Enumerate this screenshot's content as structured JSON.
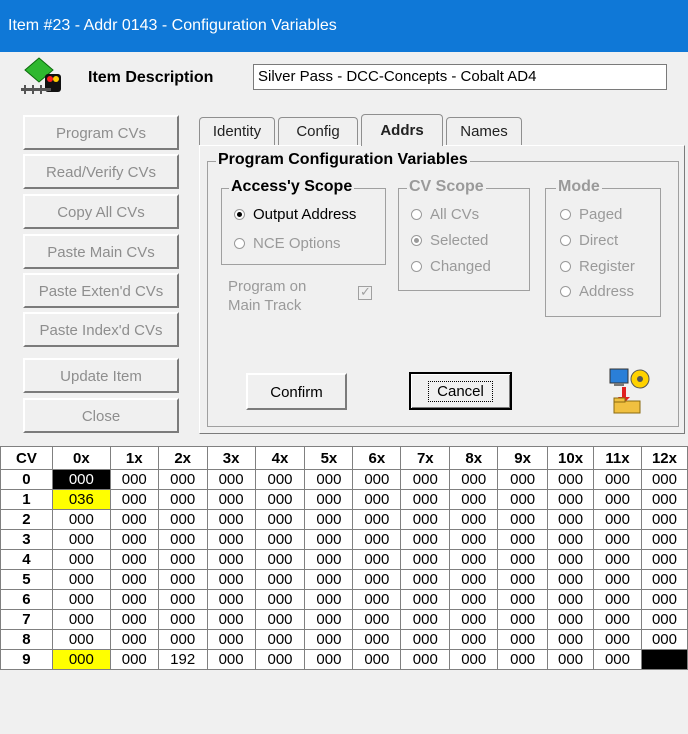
{
  "window": {
    "title": "Item #23 - Addr 0143 - Configuration Variables"
  },
  "header": {
    "desc_label": "Item Description",
    "desc_value": "Silver Pass - DCC-Concepts - Cobalt AD4"
  },
  "buttons": {
    "program_cvs": "Program CVs",
    "read_verify": "Read/Verify CVs",
    "copy_all": "Copy All CVs",
    "paste_main": "Paste Main CVs",
    "paste_extend": "Paste Exten'd CVs",
    "paste_index": "Paste Index'd CVs",
    "update_item": "Update Item",
    "close": "Close",
    "confirm": "Confirm",
    "cancel": "Cancel"
  },
  "tabs": [
    "Identity",
    "Config",
    "Addrs",
    "Names"
  ],
  "panel": {
    "title": "Program Configuration Variables",
    "access_scope": {
      "label": "Access'y Scope",
      "options": [
        "Output Address",
        "NCE Options"
      ],
      "selected": "Output Address"
    },
    "cv_scope": {
      "label": "CV Scope",
      "options": [
        "All CVs",
        "Selected",
        "Changed"
      ],
      "selected": "Selected"
    },
    "mode": {
      "label": "Mode",
      "options": [
        "Paged",
        "Direct",
        "Register",
        "Address"
      ],
      "selected": ""
    },
    "program_on_main": {
      "label_line1": "Program on",
      "label_line2": "Main Track",
      "checked": true
    }
  },
  "grid": {
    "corner": "CV",
    "columns": [
      "0x",
      "1x",
      "2x",
      "3x",
      "4x",
      "5x",
      "6x",
      "7x",
      "8x",
      "9x",
      "10x",
      "11x",
      "12x"
    ],
    "rows": [
      {
        "label": "0",
        "cells": [
          "000",
          "000",
          "000",
          "000",
          "000",
          "000",
          "000",
          "000",
          "000",
          "000",
          "000",
          "000",
          "000"
        ]
      },
      {
        "label": "1",
        "cells": [
          "036",
          "000",
          "000",
          "000",
          "000",
          "000",
          "000",
          "000",
          "000",
          "000",
          "000",
          "000",
          "000"
        ]
      },
      {
        "label": "2",
        "cells": [
          "000",
          "000",
          "000",
          "000",
          "000",
          "000",
          "000",
          "000",
          "000",
          "000",
          "000",
          "000",
          "000"
        ]
      },
      {
        "label": "3",
        "cells": [
          "000",
          "000",
          "000",
          "000",
          "000",
          "000",
          "000",
          "000",
          "000",
          "000",
          "000",
          "000",
          "000"
        ]
      },
      {
        "label": "4",
        "cells": [
          "000",
          "000",
          "000",
          "000",
          "000",
          "000",
          "000",
          "000",
          "000",
          "000",
          "000",
          "000",
          "000"
        ]
      },
      {
        "label": "5",
        "cells": [
          "000",
          "000",
          "000",
          "000",
          "000",
          "000",
          "000",
          "000",
          "000",
          "000",
          "000",
          "000",
          "000"
        ]
      },
      {
        "label": "6",
        "cells": [
          "000",
          "000",
          "000",
          "000",
          "000",
          "000",
          "000",
          "000",
          "000",
          "000",
          "000",
          "000",
          "000"
        ]
      },
      {
        "label": "7",
        "cells": [
          "000",
          "000",
          "000",
          "000",
          "000",
          "000",
          "000",
          "000",
          "000",
          "000",
          "000",
          "000",
          "000"
        ]
      },
      {
        "label": "8",
        "cells": [
          "000",
          "000",
          "000",
          "000",
          "000",
          "000",
          "000",
          "000",
          "000",
          "000",
          "000",
          "000",
          "000"
        ]
      },
      {
        "label": "9",
        "cells": [
          "000",
          "000",
          "192",
          "000",
          "000",
          "000",
          "000",
          "000",
          "000",
          "000",
          "000",
          "000",
          ""
        ]
      }
    ],
    "selected_cell": "CV 0 / 0x",
    "highlight_color": "#ffff00"
  }
}
